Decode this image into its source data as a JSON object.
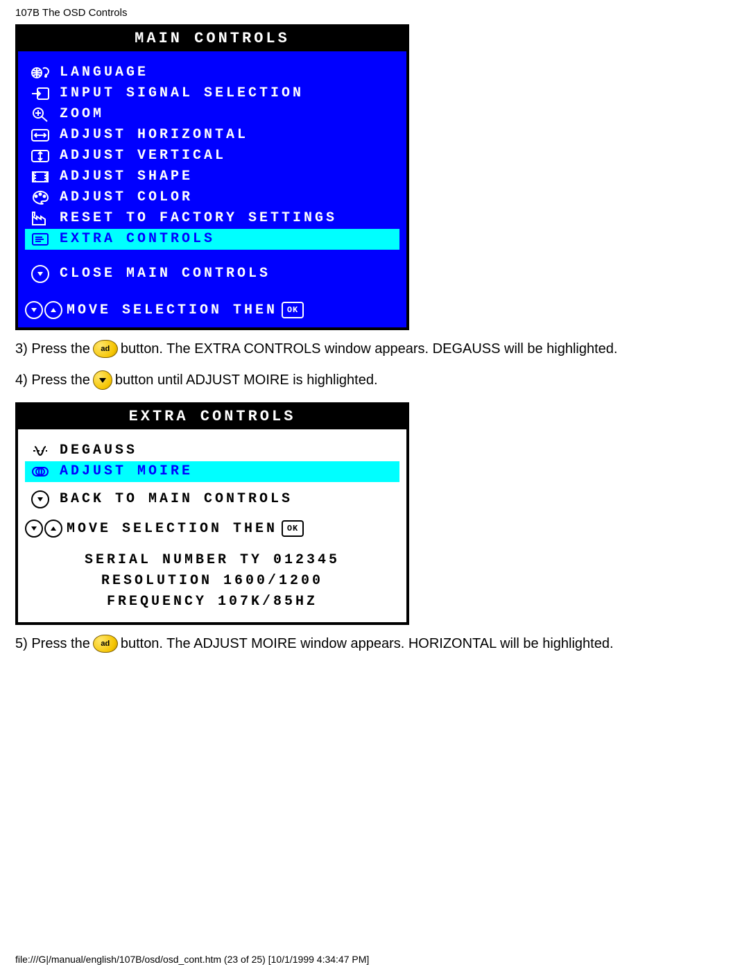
{
  "header": {
    "title": "107B The OSD Controls"
  },
  "main_panel": {
    "title": "MAIN CONTROLS",
    "items": [
      {
        "label": "LANGUAGE"
      },
      {
        "label": "INPUT SIGNAL SELECTION"
      },
      {
        "label": "ZOOM"
      },
      {
        "label": "ADJUST HORIZONTAL"
      },
      {
        "label": "ADJUST VERTICAL"
      },
      {
        "label": "ADJUST SHAPE"
      },
      {
        "label": "ADJUST COLOR"
      },
      {
        "label": "RESET TO FACTORY SETTINGS"
      },
      {
        "label": "EXTRA CONTROLS"
      }
    ],
    "highlighted_index": 8,
    "close_label": "CLOSE MAIN CONTROLS",
    "footer_hint": "MOVE SELECTION THEN",
    "footer_ok": "OK"
  },
  "step3": {
    "prefix": "3) Press the",
    "suffix": "button. The EXTRA CONTROLS window appears. DEGAUSS will be highlighted.",
    "btn": "ad"
  },
  "step4": {
    "prefix": "4) Press the",
    "suffix": "button until ADJUST MOIRE is highlighted."
  },
  "extra_panel": {
    "title": "EXTRA CONTROLS",
    "items": [
      {
        "label": "DEGAUSS"
      },
      {
        "label": "ADJUST MOIRE"
      }
    ],
    "highlighted_index": 1,
    "back_label": "BACK TO MAIN CONTROLS",
    "footer_hint": "MOVE SELECTION THEN",
    "footer_ok": "OK",
    "info": {
      "serial": "SERIAL NUMBER TY 012345",
      "resolution": "RESOLUTION 1600/1200",
      "frequency": "FREQUENCY 107K/85HZ"
    }
  },
  "step5": {
    "prefix": "5) Press the",
    "suffix": "button. The ADJUST MOIRE window appears. HORIZONTAL will be highlighted.",
    "btn": "ad"
  },
  "status": "file:///G|/manual/english/107B/osd/osd_cont.htm (23 of 25) [10/1/1999 4:34:47 PM]"
}
